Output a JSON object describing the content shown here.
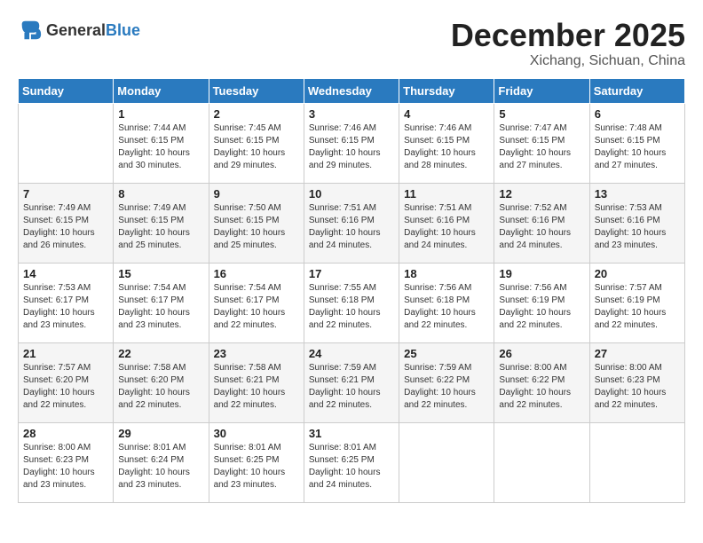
{
  "header": {
    "logo_general": "General",
    "logo_blue": "Blue",
    "month": "December 2025",
    "location": "Xichang, Sichuan, China"
  },
  "days_of_week": [
    "Sunday",
    "Monday",
    "Tuesday",
    "Wednesday",
    "Thursday",
    "Friday",
    "Saturday"
  ],
  "weeks": [
    [
      {
        "day": "",
        "sunrise": "",
        "sunset": "",
        "daylight": ""
      },
      {
        "day": "1",
        "sunrise": "Sunrise: 7:44 AM",
        "sunset": "Sunset: 6:15 PM",
        "daylight": "Daylight: 10 hours and 30 minutes."
      },
      {
        "day": "2",
        "sunrise": "Sunrise: 7:45 AM",
        "sunset": "Sunset: 6:15 PM",
        "daylight": "Daylight: 10 hours and 29 minutes."
      },
      {
        "day": "3",
        "sunrise": "Sunrise: 7:46 AM",
        "sunset": "Sunset: 6:15 PM",
        "daylight": "Daylight: 10 hours and 29 minutes."
      },
      {
        "day": "4",
        "sunrise": "Sunrise: 7:46 AM",
        "sunset": "Sunset: 6:15 PM",
        "daylight": "Daylight: 10 hours and 28 minutes."
      },
      {
        "day": "5",
        "sunrise": "Sunrise: 7:47 AM",
        "sunset": "Sunset: 6:15 PM",
        "daylight": "Daylight: 10 hours and 27 minutes."
      },
      {
        "day": "6",
        "sunrise": "Sunrise: 7:48 AM",
        "sunset": "Sunset: 6:15 PM",
        "daylight": "Daylight: 10 hours and 27 minutes."
      }
    ],
    [
      {
        "day": "7",
        "sunrise": "Sunrise: 7:49 AM",
        "sunset": "Sunset: 6:15 PM",
        "daylight": "Daylight: 10 hours and 26 minutes."
      },
      {
        "day": "8",
        "sunrise": "Sunrise: 7:49 AM",
        "sunset": "Sunset: 6:15 PM",
        "daylight": "Daylight: 10 hours and 25 minutes."
      },
      {
        "day": "9",
        "sunrise": "Sunrise: 7:50 AM",
        "sunset": "Sunset: 6:15 PM",
        "daylight": "Daylight: 10 hours and 25 minutes."
      },
      {
        "day": "10",
        "sunrise": "Sunrise: 7:51 AM",
        "sunset": "Sunset: 6:16 PM",
        "daylight": "Daylight: 10 hours and 24 minutes."
      },
      {
        "day": "11",
        "sunrise": "Sunrise: 7:51 AM",
        "sunset": "Sunset: 6:16 PM",
        "daylight": "Daylight: 10 hours and 24 minutes."
      },
      {
        "day": "12",
        "sunrise": "Sunrise: 7:52 AM",
        "sunset": "Sunset: 6:16 PM",
        "daylight": "Daylight: 10 hours and 24 minutes."
      },
      {
        "day": "13",
        "sunrise": "Sunrise: 7:53 AM",
        "sunset": "Sunset: 6:16 PM",
        "daylight": "Daylight: 10 hours and 23 minutes."
      }
    ],
    [
      {
        "day": "14",
        "sunrise": "Sunrise: 7:53 AM",
        "sunset": "Sunset: 6:17 PM",
        "daylight": "Daylight: 10 hours and 23 minutes."
      },
      {
        "day": "15",
        "sunrise": "Sunrise: 7:54 AM",
        "sunset": "Sunset: 6:17 PM",
        "daylight": "Daylight: 10 hours and 23 minutes."
      },
      {
        "day": "16",
        "sunrise": "Sunrise: 7:54 AM",
        "sunset": "Sunset: 6:17 PM",
        "daylight": "Daylight: 10 hours and 22 minutes."
      },
      {
        "day": "17",
        "sunrise": "Sunrise: 7:55 AM",
        "sunset": "Sunset: 6:18 PM",
        "daylight": "Daylight: 10 hours and 22 minutes."
      },
      {
        "day": "18",
        "sunrise": "Sunrise: 7:56 AM",
        "sunset": "Sunset: 6:18 PM",
        "daylight": "Daylight: 10 hours and 22 minutes."
      },
      {
        "day": "19",
        "sunrise": "Sunrise: 7:56 AM",
        "sunset": "Sunset: 6:19 PM",
        "daylight": "Daylight: 10 hours and 22 minutes."
      },
      {
        "day": "20",
        "sunrise": "Sunrise: 7:57 AM",
        "sunset": "Sunset: 6:19 PM",
        "daylight": "Daylight: 10 hours and 22 minutes."
      }
    ],
    [
      {
        "day": "21",
        "sunrise": "Sunrise: 7:57 AM",
        "sunset": "Sunset: 6:20 PM",
        "daylight": "Daylight: 10 hours and 22 minutes."
      },
      {
        "day": "22",
        "sunrise": "Sunrise: 7:58 AM",
        "sunset": "Sunset: 6:20 PM",
        "daylight": "Daylight: 10 hours and 22 minutes."
      },
      {
        "day": "23",
        "sunrise": "Sunrise: 7:58 AM",
        "sunset": "Sunset: 6:21 PM",
        "daylight": "Daylight: 10 hours and 22 minutes."
      },
      {
        "day": "24",
        "sunrise": "Sunrise: 7:59 AM",
        "sunset": "Sunset: 6:21 PM",
        "daylight": "Daylight: 10 hours and 22 minutes."
      },
      {
        "day": "25",
        "sunrise": "Sunrise: 7:59 AM",
        "sunset": "Sunset: 6:22 PM",
        "daylight": "Daylight: 10 hours and 22 minutes."
      },
      {
        "day": "26",
        "sunrise": "Sunrise: 8:00 AM",
        "sunset": "Sunset: 6:22 PM",
        "daylight": "Daylight: 10 hours and 22 minutes."
      },
      {
        "day": "27",
        "sunrise": "Sunrise: 8:00 AM",
        "sunset": "Sunset: 6:23 PM",
        "daylight": "Daylight: 10 hours and 22 minutes."
      }
    ],
    [
      {
        "day": "28",
        "sunrise": "Sunrise: 8:00 AM",
        "sunset": "Sunset: 6:23 PM",
        "daylight": "Daylight: 10 hours and 23 minutes."
      },
      {
        "day": "29",
        "sunrise": "Sunrise: 8:01 AM",
        "sunset": "Sunset: 6:24 PM",
        "daylight": "Daylight: 10 hours and 23 minutes."
      },
      {
        "day": "30",
        "sunrise": "Sunrise: 8:01 AM",
        "sunset": "Sunset: 6:25 PM",
        "daylight": "Daylight: 10 hours and 23 minutes."
      },
      {
        "day": "31",
        "sunrise": "Sunrise: 8:01 AM",
        "sunset": "Sunset: 6:25 PM",
        "daylight": "Daylight: 10 hours and 24 minutes."
      },
      {
        "day": "",
        "sunrise": "",
        "sunset": "",
        "daylight": ""
      },
      {
        "day": "",
        "sunrise": "",
        "sunset": "",
        "daylight": ""
      },
      {
        "day": "",
        "sunrise": "",
        "sunset": "",
        "daylight": ""
      }
    ]
  ]
}
